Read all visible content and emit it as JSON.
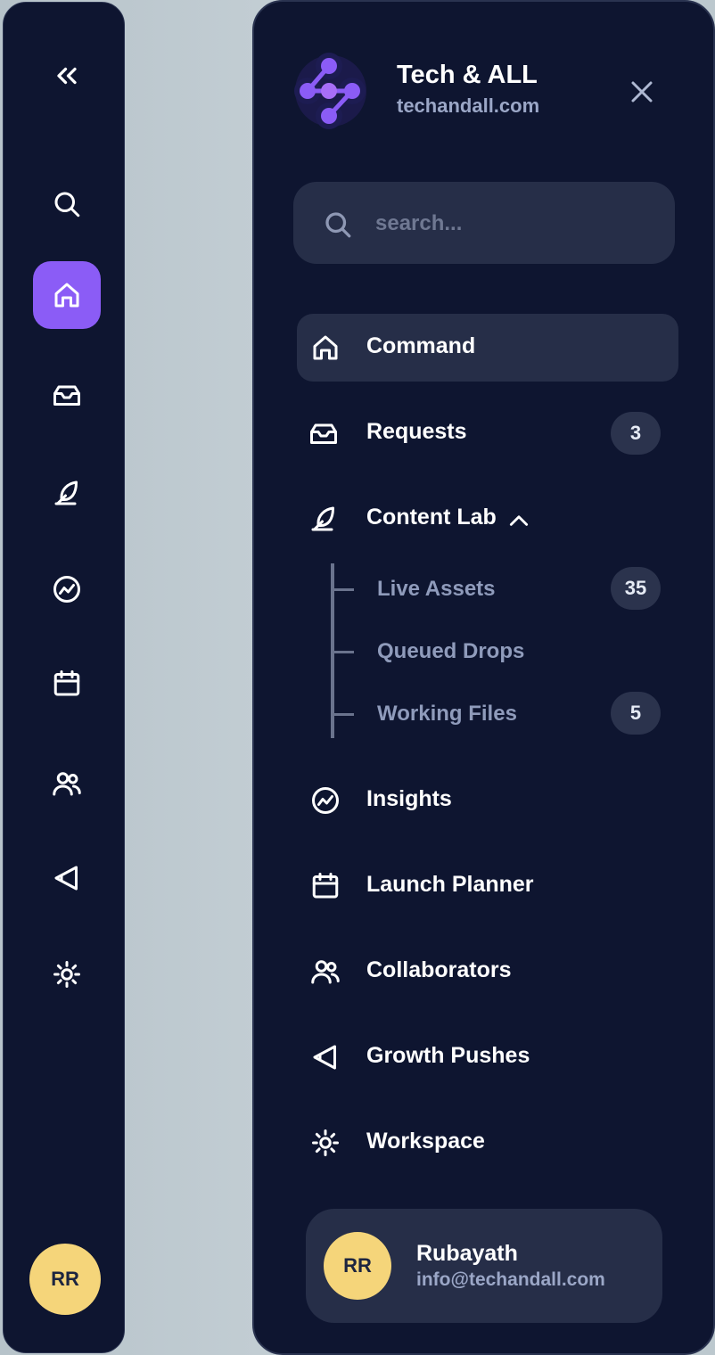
{
  "brand": {
    "name": "Tech & ALL",
    "domain": "techandall.com"
  },
  "search": {
    "placeholder": "search..."
  },
  "nav": {
    "command": "Command",
    "requests": {
      "label": "Requests",
      "count": "3"
    },
    "content_lab": {
      "label": "Content Lab",
      "children": [
        {
          "label": "Live Assets",
          "count": "35"
        },
        {
          "label": "Queued Drops"
        },
        {
          "label": "Working Files",
          "count": "5"
        }
      ]
    },
    "insights": "Insights",
    "launch_planner": "Launch Planner",
    "collaborators": "Collaborators",
    "growth_pushes": "Growth Pushes",
    "workspace": "Workspace"
  },
  "user": {
    "initials": "RR",
    "name": "Rubayath",
    "email": "info@techandall.com"
  },
  "colors": {
    "accent": "#8b5cf6",
    "background": "#0e1530",
    "surface": "#262e48",
    "avatar": "#f5d57a"
  }
}
